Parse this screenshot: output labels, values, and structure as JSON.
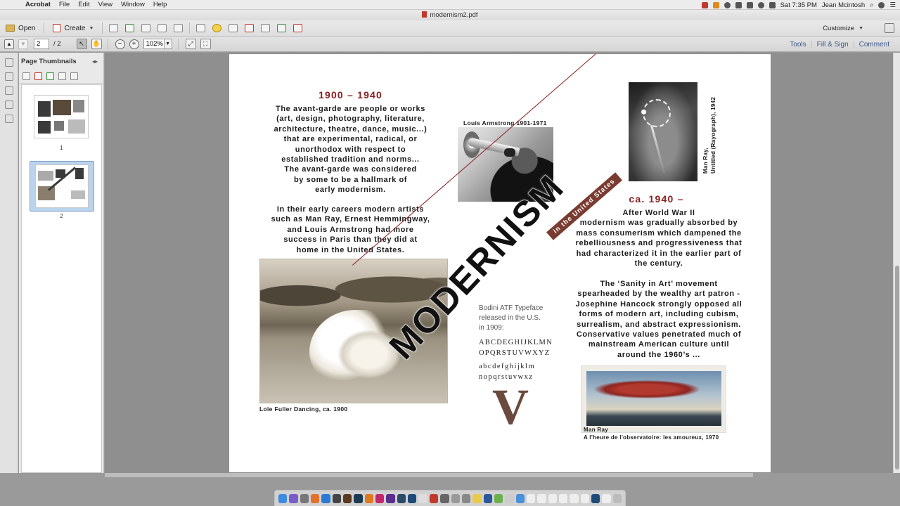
{
  "menubar": {
    "app_name": "Acrobat",
    "items": [
      "File",
      "Edit",
      "View",
      "Window",
      "Help"
    ],
    "clock": "Sat 7:35 PM",
    "user": "Jean Mcintosh"
  },
  "window": {
    "title": "modernism2.pdf"
  },
  "toolbar": {
    "open_label": "Open",
    "create_label": "Create",
    "customize_label": "Customize",
    "page_number": "2",
    "page_total": "/ 2",
    "zoom": "102%",
    "links": [
      "Tools",
      "Fill & Sign",
      "Comment"
    ]
  },
  "sidebar": {
    "panel_title": "Page Thumbnails",
    "thumbnails": [
      {
        "page": "1",
        "selected": false
      },
      {
        "page": "2",
        "selected": true
      }
    ]
  },
  "document": {
    "left_heading": "1900 – 1940",
    "left_para1": [
      "The avant-garde are people or works",
      "(art, design, photography, literature,",
      "architecture, theatre, dance, music...)",
      "that are experimental, radical, or",
      "unorthodox with respect to",
      "established tradition and norms...",
      "The avant-garde was considered",
      "by some to be a hallmark of",
      "early modernism."
    ],
    "left_para2": [
      "In their early careers modern artists",
      "such as Man Ray, Ernest Hemmingway,",
      "and Louis Armstrong had more",
      "success in Paris than they did at",
      "home in the United States."
    ],
    "armstrong_caption": "Louis Armstrong 1901-1971",
    "fuller_caption": "Loïe Fuller Dancing, ca. 1900",
    "big_title": "MODERNISM",
    "band_text": "in the United States",
    "rayograph_caption_line1": "Man Ray,",
    "rayograph_caption_line2": "Untitled (Rayograph), 1942",
    "right_heading": "ca. 1940 –",
    "right_para1": [
      "After World War II",
      "modernism was gradually absorbed by",
      "mass consumerism which dampened the",
      "rebelliousness and progressiveness that",
      "had characterized it in the earlier part of",
      "the century."
    ],
    "right_para2": [
      "The ‘Sanity in Art’ movement",
      "spearheaded by the wealthy art patron -",
      "Josephine Hancock  strongly opposed all",
      "forms of modern art, including cubism,",
      "surrealism, and abstract expressionism.",
      "Conservative values penetrated much of",
      "mainstream American culture until",
      "around the 1960’s ..."
    ],
    "bodoni_label": [
      "Bodini ATF Typeface",
      "released in the U.S.",
      "in 1909:"
    ],
    "bodoni_upper": [
      "ABCDEGHIJKLMN",
      "OPQRSTUVWXYZ"
    ],
    "bodoni_lower": [
      "abcdefghijklm",
      "nopqrstuvwxz"
    ],
    "bodoni_big_letter": "V",
    "lips_caption_line1": "Man Ray",
    "lips_caption_line2": "A l'heure de l'observatoire: les amoureux, 1970"
  },
  "colors": {
    "accent_red": "#8a2020",
    "band_brown": "#7a3b30",
    "link_blue": "#3c5a8a"
  }
}
